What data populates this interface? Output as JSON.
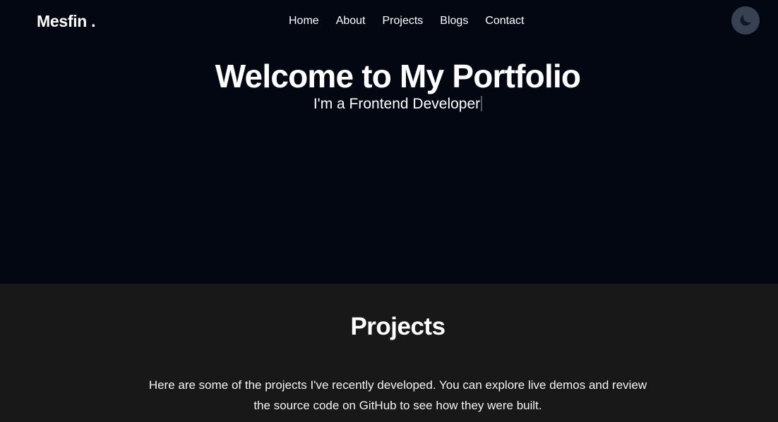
{
  "navbar": {
    "brand": "Mesfin .",
    "links": [
      {
        "label": "Home"
      },
      {
        "label": "About"
      },
      {
        "label": "Projects"
      },
      {
        "label": "Blogs"
      },
      {
        "label": "Contact"
      }
    ],
    "theme_toggle_icon": "moon-icon"
  },
  "hero": {
    "title": "Welcome to My Portfolio",
    "subtitle": "I'm a Frontend Developer"
  },
  "projects": {
    "title": "Projects",
    "description": "Here are some of the projects I've recently developed. You can explore live demos and review the source code on GitHub to see how they were built."
  },
  "colors": {
    "hero_background": "#030712",
    "section_background": "#181818",
    "toggle_background": "#374151",
    "text": "#ffffff"
  }
}
